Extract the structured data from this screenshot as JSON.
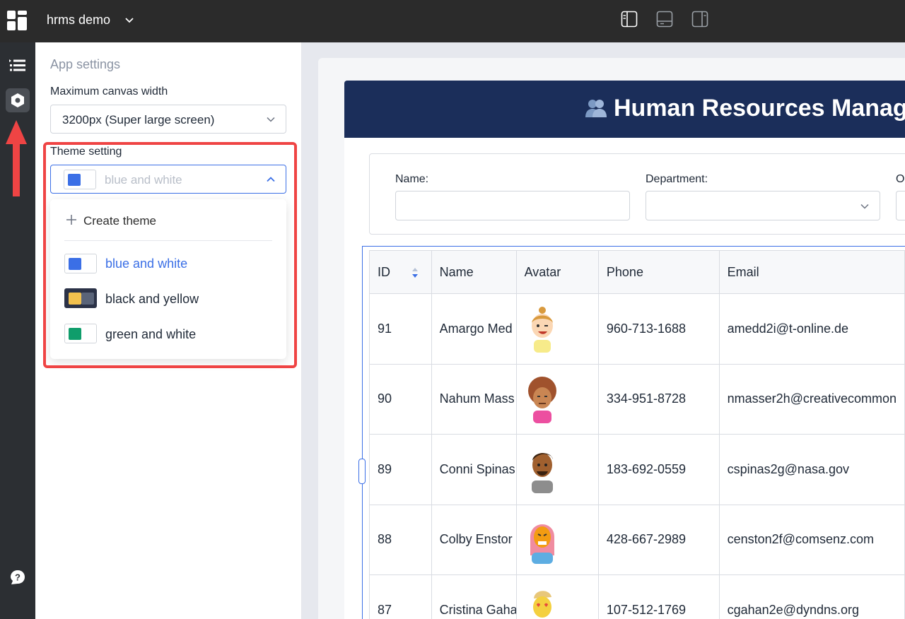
{
  "topbar": {
    "app_name": "hrms demo"
  },
  "settings": {
    "title": "App settings",
    "canvas_width_label": "Maximum canvas width",
    "canvas_width_value": "3200px (Super large screen)",
    "theme_label": "Theme setting",
    "theme_placeholder": "blue and white",
    "create_theme": "Create theme",
    "themes": [
      {
        "label": "blue and white",
        "selected": true,
        "colors": [
          "#3b6fe6",
          "#ffffff"
        ]
      },
      {
        "label": "black and yellow",
        "selected": false,
        "colors": [
          "#f2c14e",
          "#5a6479"
        ],
        "bg": "#2b3247"
      },
      {
        "label": "green and white",
        "selected": false,
        "colors": [
          "#0f9d6b",
          "#ffffff"
        ]
      }
    ]
  },
  "colors": {
    "accent": "#3b6fe6",
    "highlight": "#ef4444",
    "banner": "#1b2e5a"
  },
  "app": {
    "banner_title": "Human Resources Manage",
    "filters": {
      "name_label": "Name:",
      "department_label": "Department:",
      "other_label": "O"
    },
    "table": {
      "columns": [
        "ID",
        "Name",
        "Avatar",
        "Phone",
        "Email"
      ],
      "rows": [
        {
          "id": "91",
          "name": "Amargo Med",
          "phone": "960-713-1688",
          "email": "amedd2i@t-online.de"
        },
        {
          "id": "90",
          "name": "Nahum Mass",
          "phone": "334-951-8728",
          "email": "nmasser2h@creativecommon"
        },
        {
          "id": "89",
          "name": "Conni Spinas",
          "phone": "183-692-0559",
          "email": "cspinas2g@nasa.gov"
        },
        {
          "id": "88",
          "name": "Colby Enstor",
          "phone": "428-667-2989",
          "email": "censton2f@comsenz.com"
        },
        {
          "id": "87",
          "name": "Cristina Gaha",
          "phone": "107-512-1769",
          "email": "cgahan2e@dyndns.org"
        }
      ]
    }
  }
}
